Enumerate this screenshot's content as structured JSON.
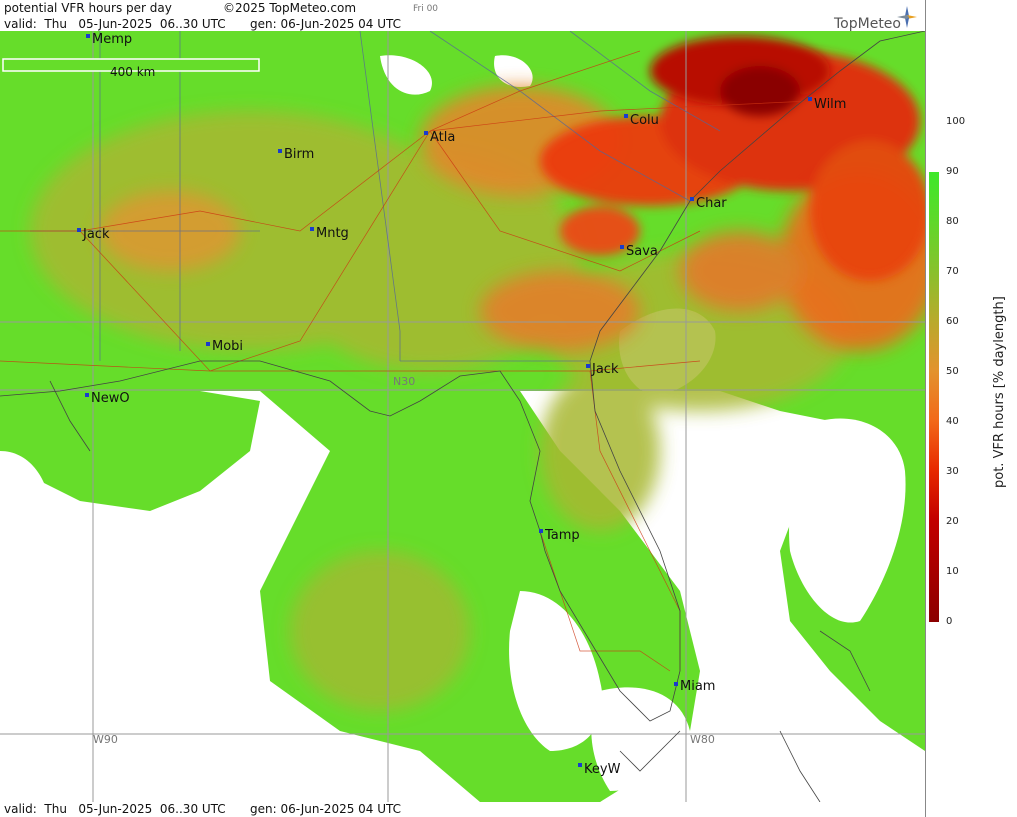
{
  "header": {
    "product_title": "potential VFR hours per day",
    "copyright": "©2025 TopMeteo.com",
    "run_label": "Fri 00",
    "valid_line": "valid:  Thu   05-Jun-2025  06..30 UTC",
    "gen_line": "gen: 06-Jun-2025 04 UTC",
    "logo": "TopMeteo"
  },
  "footer": {
    "valid_line": "valid:  Thu   05-Jun-2025  06..30 UTC",
    "gen_line": "gen: 06-Jun-2025 04 UTC"
  },
  "map": {
    "scale_bar_label": "400 km",
    "grid_labels": {
      "lat": "N30",
      "lon_west": "W90",
      "lon_east": "W80"
    },
    "cities": [
      {
        "name": "Memp"
      },
      {
        "name": "Wilm"
      },
      {
        "name": "Colu"
      },
      {
        "name": "Atla"
      },
      {
        "name": "Birm"
      },
      {
        "name": "Char"
      },
      {
        "name": "Jack"
      },
      {
        "name": "Mntg"
      },
      {
        "name": "Sava"
      },
      {
        "name": "Mobi"
      },
      {
        "name": "Jack"
      },
      {
        "name": "NewO"
      },
      {
        "name": "Tamp"
      },
      {
        "name": "Miam"
      },
      {
        "name": "KeyW"
      }
    ]
  },
  "legend": {
    "title": "pot. VFR hours [% daylength]",
    "ticks": [
      "100",
      "90",
      "80",
      "70",
      "60",
      "50",
      "40",
      "30",
      "20",
      "10",
      "0"
    ],
    "colors": [
      "#8b0000",
      "#c30000",
      "#e82a00",
      "#f26a1a",
      "#e2932e",
      "#b8aa2c",
      "#88c12c",
      "#5fd82a",
      "#3ee82a"
    ]
  }
}
